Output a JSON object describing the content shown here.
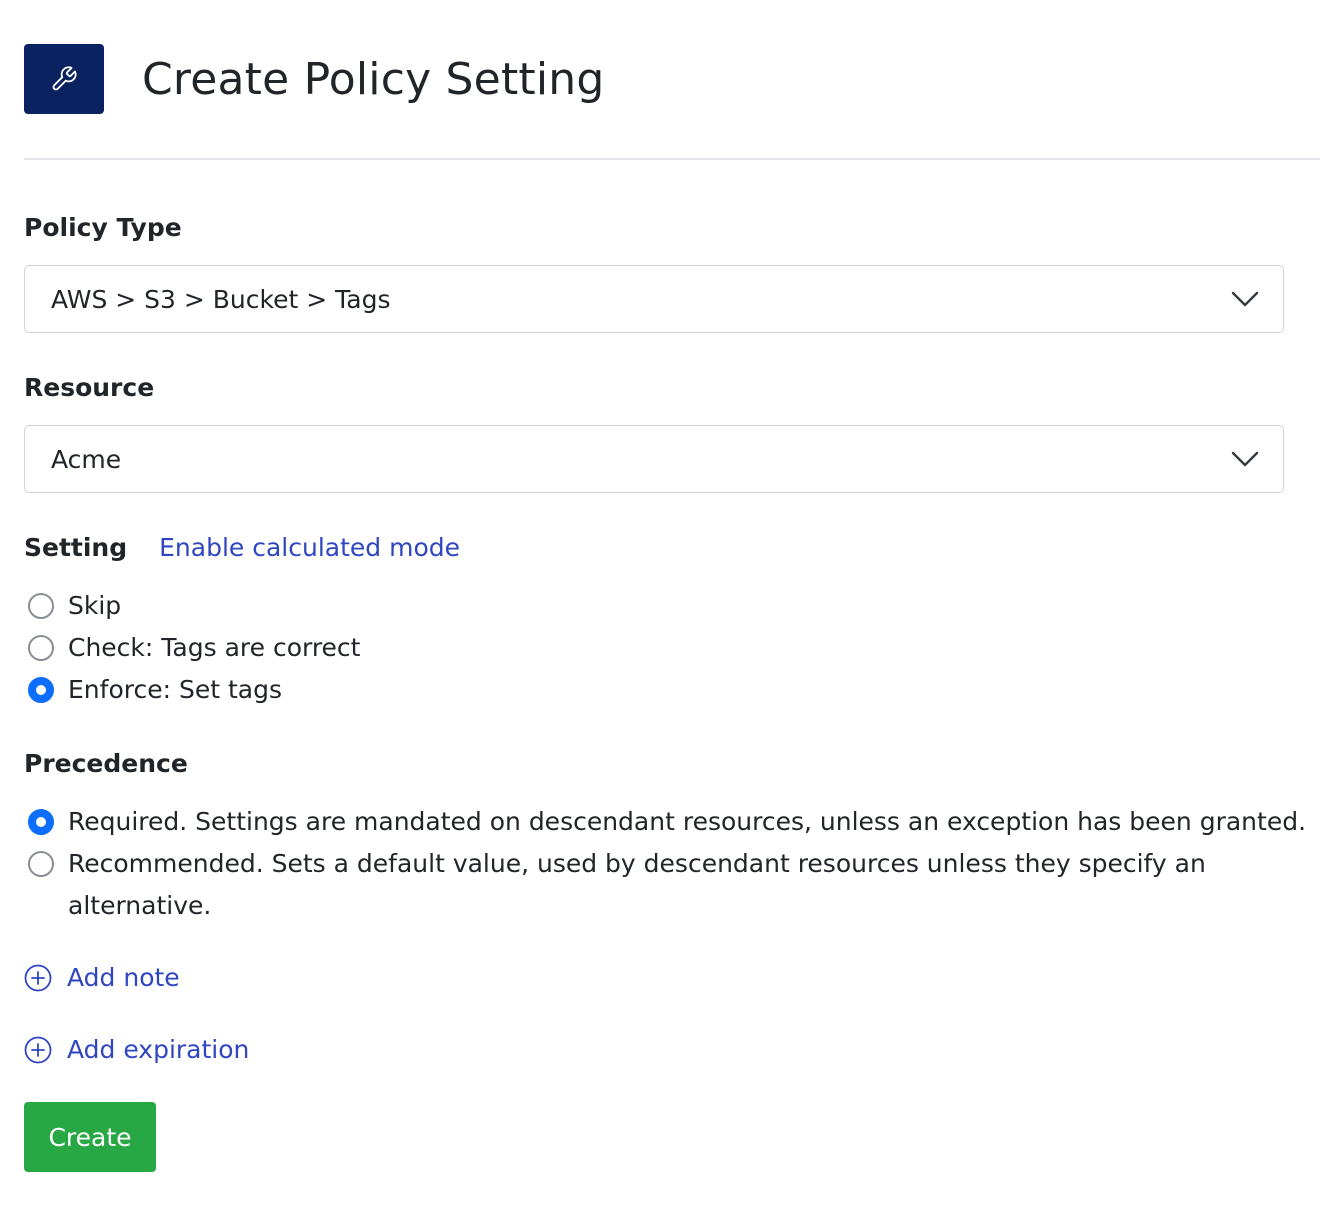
{
  "header": {
    "icon": "wrench-icon",
    "title": "Create Policy Setting"
  },
  "policy_type": {
    "label": "Policy Type",
    "value": "AWS > S3 > Bucket > Tags"
  },
  "resource": {
    "label": "Resource",
    "value": "Acme"
  },
  "setting": {
    "label": "Setting",
    "calculated_mode_link": "Enable calculated mode",
    "options": [
      {
        "label": "Skip",
        "checked": false
      },
      {
        "label": "Check: Tags are correct",
        "checked": false
      },
      {
        "label": "Enforce: Set tags",
        "checked": true
      }
    ]
  },
  "precedence": {
    "label": "Precedence",
    "options": [
      {
        "label": "Required. Settings are mandated on descendant resources, unless an exception has been granted.",
        "checked": true
      },
      {
        "label": "Recommended. Sets a default value, used by descendant resources unless they specify an alternative.",
        "checked": false
      }
    ]
  },
  "actions": {
    "add_note": "Add note",
    "add_expiration": "Add expiration",
    "create": "Create"
  },
  "colors": {
    "header_icon_bg": "#0b2260",
    "link": "#2f46c0",
    "radio_checked": "#0d6efd",
    "create_button": "#28a745"
  }
}
